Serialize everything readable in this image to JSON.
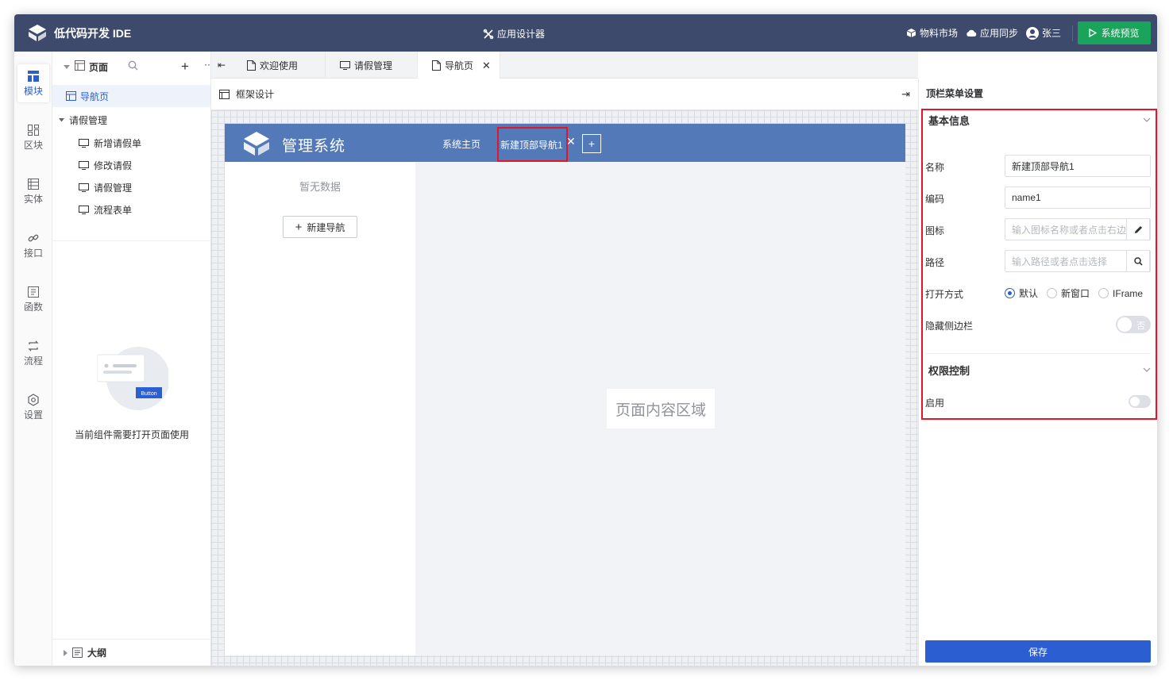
{
  "header": {
    "app_title": "低代码开发 IDE",
    "designer_label": "应用设计器",
    "market_label": "物料市场",
    "sync_label": "应用同步",
    "user_name": "张三",
    "preview_label": "系统预览"
  },
  "rail": {
    "items": [
      {
        "label": "模块",
        "icon": "module-icon"
      },
      {
        "label": "区块",
        "icon": "block-icon"
      },
      {
        "label": "实体",
        "icon": "entity-icon"
      },
      {
        "label": "接口",
        "icon": "api-icon"
      },
      {
        "label": "函数",
        "icon": "function-icon"
      },
      {
        "label": "流程",
        "icon": "flow-icon"
      },
      {
        "label": "设置",
        "icon": "settings-icon"
      }
    ]
  },
  "tree": {
    "header_label": "页面",
    "root_page": "导航页",
    "group_label": "请假管理",
    "children": [
      "新增请假单",
      "修改请假",
      "请假管理",
      "流程表单"
    ],
    "empty_badge": "Button",
    "empty_text": "当前组件需要打开页面使用",
    "outline_label": "大纲"
  },
  "tabs": [
    {
      "label": "欢迎使用"
    },
    {
      "label": "请假管理"
    },
    {
      "label": "导航页"
    }
  ],
  "frame": {
    "title": "框架设计",
    "app_name": "管理系统",
    "nav_home": "系统主页",
    "nav_new": "新建顶部导航1",
    "add_symbol": "+",
    "no_data": "暂无数据",
    "new_nav_label": "新建导航",
    "content_area": "页面内容区域"
  },
  "settings": {
    "title": "顶栏菜单设置",
    "basic_section": "基本信息",
    "name_label": "名称",
    "name_value": "新建顶部导航1",
    "code_label": "编码",
    "code_value": "name1",
    "icon_label": "图标",
    "icon_placeholder": "输入图标名称或者点击右边",
    "path_label": "路径",
    "path_placeholder": "输入路径或者点击选择",
    "open_label": "打开方式",
    "open_options": [
      "默认",
      "新窗口",
      "IFrame"
    ],
    "open_selected": "默认",
    "hide_sidebar_label": "隐藏侧边栏",
    "hide_sidebar_value": "否",
    "perm_section": "权限控制",
    "enable_label": "启用",
    "save_label": "保存"
  }
}
